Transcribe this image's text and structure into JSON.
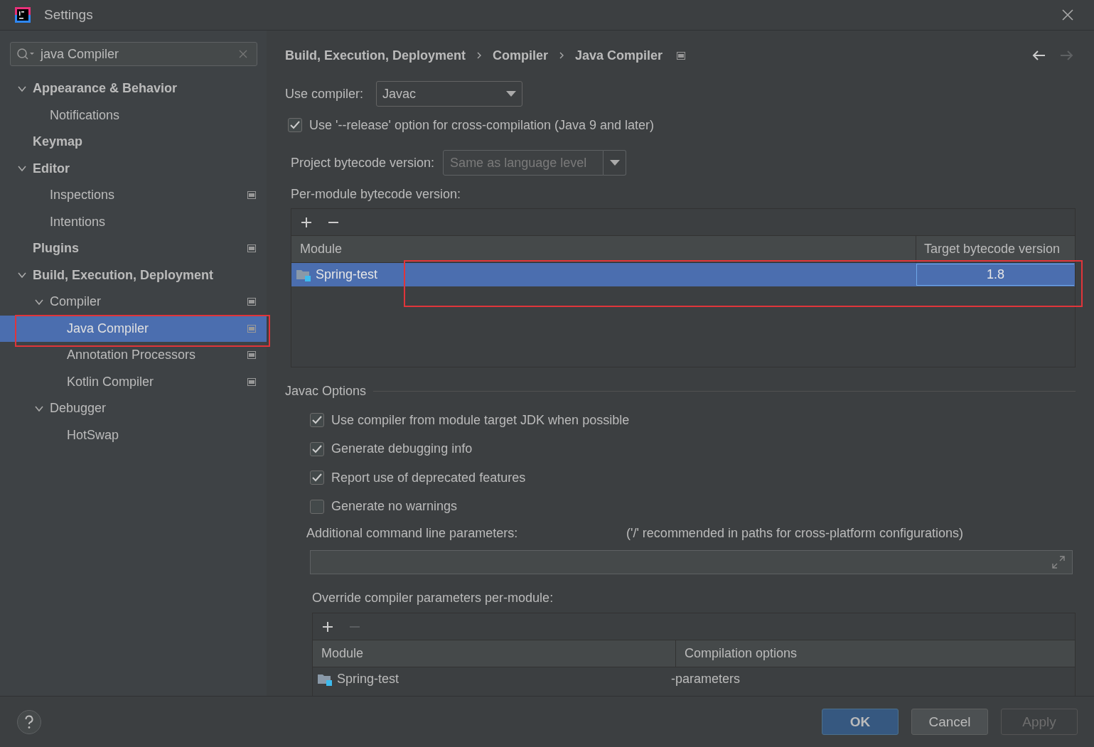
{
  "window": {
    "title": "Settings"
  },
  "sidebar": {
    "search": {
      "value": "java Compiler"
    },
    "items": [
      {
        "label": "Appearance & Behavior",
        "expanded": true,
        "page_icon": false,
        "selected": false,
        "highlighted": false,
        "children": [
          {
            "label": "Notifications",
            "page_icon": false,
            "selected": false,
            "highlighted": false
          }
        ]
      },
      {
        "label": "Keymap",
        "page_icon": false,
        "selected": false,
        "highlighted": false
      },
      {
        "label": "Editor",
        "expanded": true,
        "page_icon": false,
        "selected": false,
        "highlighted": false,
        "children": [
          {
            "label": "Inspections",
            "page_icon": true,
            "selected": false,
            "highlighted": false
          },
          {
            "label": "Intentions",
            "page_icon": false,
            "selected": false,
            "highlighted": false
          }
        ]
      },
      {
        "label": "Plugins",
        "page_icon": true,
        "selected": false,
        "highlighted": false
      },
      {
        "label": "Build, Execution, Deployment",
        "expanded": true,
        "page_icon": false,
        "selected": false,
        "highlighted": false,
        "children": [
          {
            "label": "Compiler",
            "expanded": true,
            "page_icon": true,
            "selected": false,
            "highlighted": false,
            "children": [
              {
                "label": "Java Compiler",
                "page_icon": true,
                "selected": true,
                "highlighted": true
              },
              {
                "label": "Annotation Processors",
                "page_icon": true,
                "selected": false,
                "highlighted": false
              },
              {
                "label": "Kotlin Compiler",
                "page_icon": true,
                "selected": false,
                "highlighted": false
              }
            ]
          },
          {
            "label": "Debugger",
            "expanded": true,
            "page_icon": false,
            "selected": false,
            "highlighted": false,
            "children": [
              {
                "label": "HotSwap",
                "page_icon": false,
                "selected": false,
                "highlighted": false
              }
            ]
          }
        ]
      }
    ]
  },
  "breadcrumb": [
    "Build, Execution, Deployment",
    "Compiler",
    "Java Compiler"
  ],
  "nav": {
    "back_enabled": true,
    "forward_enabled": false
  },
  "use_compiler": {
    "label": "Use compiler:",
    "value": "Javac"
  },
  "release_option": {
    "label": "Use '--release' option for cross-compilation (Java 9 and later)",
    "checked": true
  },
  "project_bytecode": {
    "label": "Project bytecode version:",
    "placeholder": "Same as language level"
  },
  "per_module": {
    "label": "Per-module bytecode version:",
    "remove_enabled": true,
    "columns": [
      "Module",
      "Target bytecode version"
    ],
    "rows": [
      {
        "module": "Spring-test",
        "version": "1.8",
        "selected": true,
        "highlighted": true
      }
    ]
  },
  "javac_options": {
    "title": "Javac Options",
    "checkboxes": [
      {
        "label": "Use compiler from module target JDK when possible",
        "checked": true
      },
      {
        "label": "Generate debugging info",
        "checked": true
      },
      {
        "label": "Report use of deprecated features",
        "checked": true
      },
      {
        "label": "Generate no warnings",
        "checked": false
      }
    ],
    "additional_label": "Additional command line parameters:",
    "additional_hint": "('/' recommended in paths for cross-platform configurations)",
    "override": {
      "label": "Override compiler parameters per-module:",
      "remove_enabled": false,
      "columns": [
        "Module",
        "Compilation options"
      ],
      "rows": [
        {
          "module": "Spring-test",
          "options": "-parameters"
        }
      ]
    }
  },
  "buttons": [
    {
      "label": "OK",
      "kind": "primary",
      "disabled": false
    },
    {
      "label": "Cancel",
      "kind": "normal",
      "disabled": false
    },
    {
      "label": "Apply",
      "kind": "normal",
      "disabled": true
    }
  ]
}
